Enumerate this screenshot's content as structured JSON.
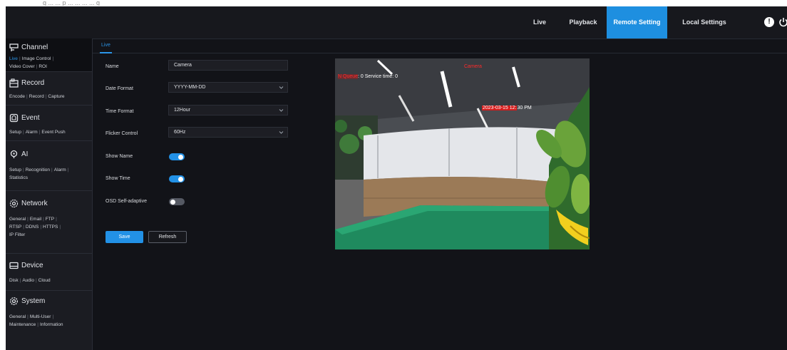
{
  "caption": "g ... ... p ... ... ... ... g",
  "topnav": {
    "live": "Live",
    "playback": "Playback",
    "remote_setting": "Remote Setting",
    "local_settings": "Local Settings",
    "info_glyph": "!"
  },
  "sidebar": {
    "channel": {
      "title": "Channel",
      "links": [
        "Live",
        "Image Control",
        "Video Cover",
        "ROI"
      ]
    },
    "record": {
      "title": "Record",
      "links": [
        "Encode",
        "Record",
        "Capture"
      ]
    },
    "event": {
      "title": "Event",
      "links": [
        "Setup",
        "Alarm",
        "Event Push"
      ]
    },
    "ai": {
      "title": "AI",
      "links": [
        "Setup",
        "Recognition",
        "Alarm",
        "Statistics"
      ]
    },
    "network": {
      "title": "Network",
      "links": [
        "General",
        "Email",
        "FTP",
        "RTSP",
        "DDNS",
        "HTTPS",
        "IP Filter"
      ]
    },
    "device": {
      "title": "Device",
      "links": [
        "Disk",
        "Audio",
        "Cloud"
      ]
    },
    "system": {
      "title": "System",
      "links": [
        "General",
        "Multi-User",
        "Maintenance",
        "Information"
      ]
    }
  },
  "tabs": {
    "live": "Live"
  },
  "form": {
    "name_label": "Name",
    "name_value": "Camera",
    "date_format_label": "Date Format",
    "date_format_value": "YYYY-MM-DD",
    "time_format_label": "Time Format",
    "time_format_value": "12Hour",
    "flicker_label": "Flicker Control",
    "flicker_value": "60Hz",
    "show_name_label": "Show Name",
    "show_name_on": true,
    "show_time_label": "Show Time",
    "show_time_on": true,
    "osd_label": "OSD Self-adaptive",
    "osd_on": false
  },
  "buttons": {
    "save": "Save",
    "refresh": "Refresh"
  },
  "preview": {
    "osd_camera": "Camera",
    "osd_status_red": "N Queue",
    "osd_status_rest": ": 0 Service time: 0",
    "osd_time_red": "2023-03-15 12:",
    "osd_time_rest": "30 PM"
  },
  "colors": {
    "accent": "#1e8fe0",
    "background": "#121318",
    "sidebar": "#1b1c22"
  }
}
